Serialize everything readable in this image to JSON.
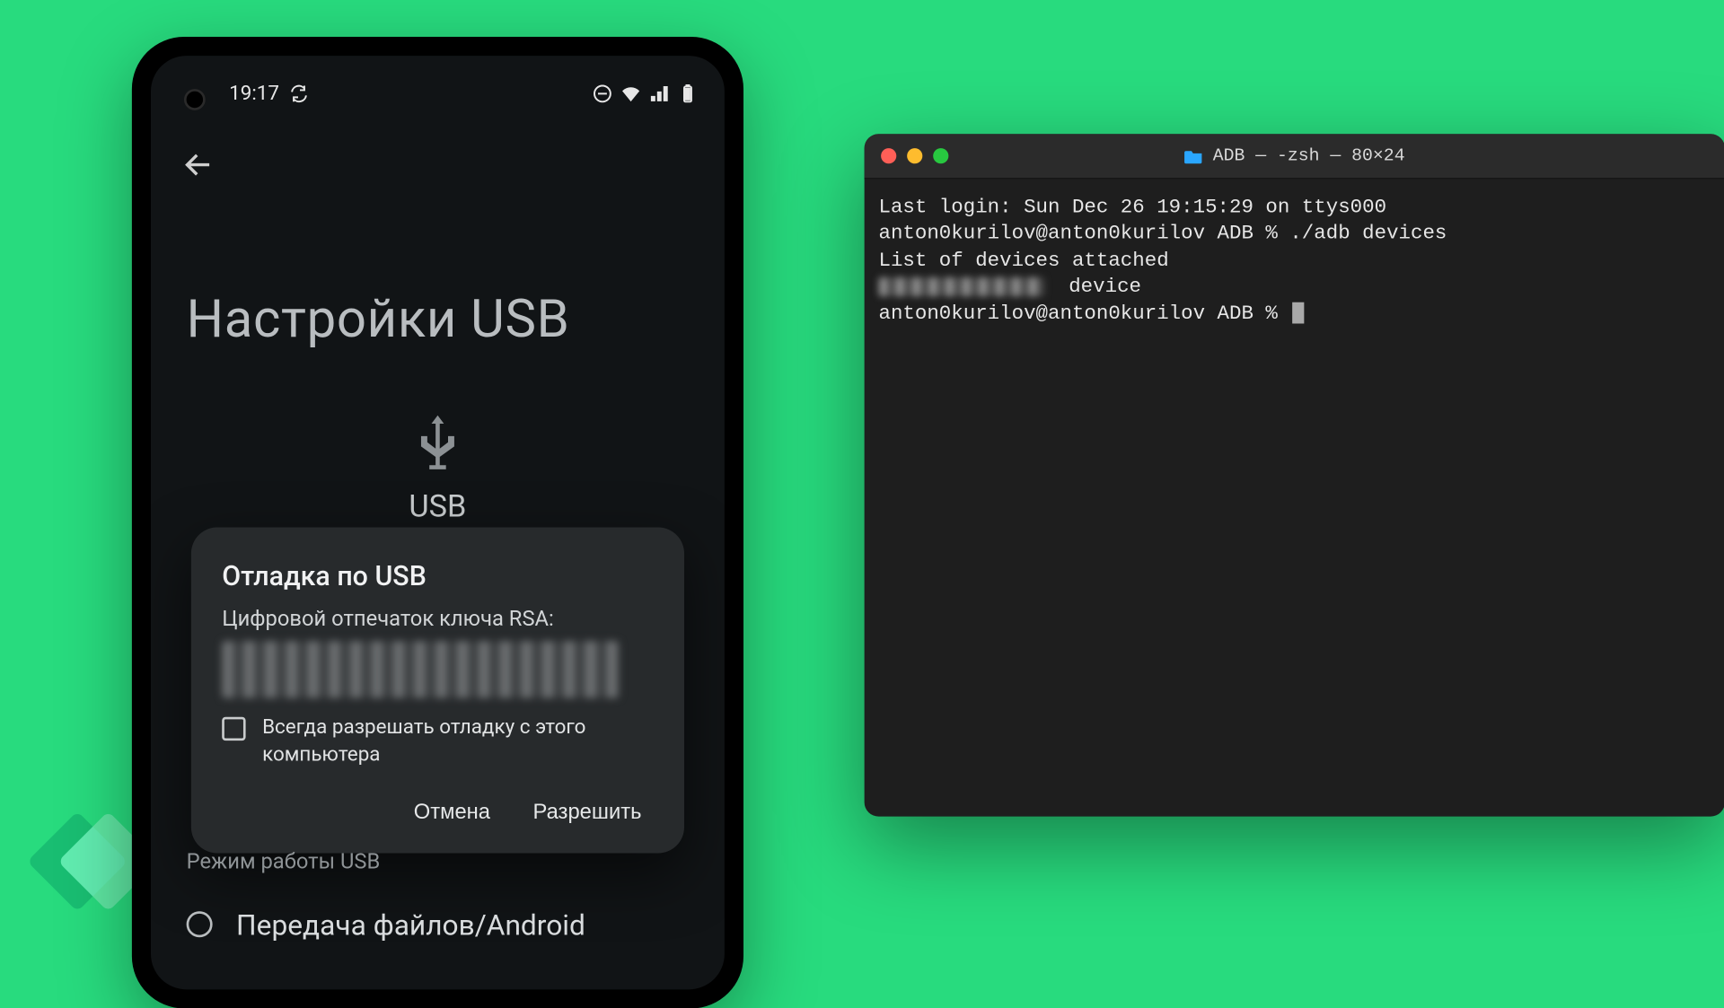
{
  "phone": {
    "status": {
      "time": "19:17",
      "sync_icon": "sync-icon",
      "dnd_icon": "do-not-disturb-icon",
      "wifi_icon": "wifi-icon",
      "signal_icon": "cellular-icon",
      "battery_icon": "battery-icon"
    },
    "back_icon": "back-arrow-icon",
    "page_title": "Настройки USB",
    "usb": {
      "icon": "usb-icon",
      "label": "USB"
    },
    "section_label": "Режим работы USB",
    "option_file_transfer": "Передача файлов/Android",
    "dialog": {
      "title": "Отладка по USB",
      "subtitle": "Цифровой отпечаток ключа RSA:",
      "checkbox_label": "Всегда разрешать отладку с этого компьютера",
      "btn_cancel": "Отмена",
      "btn_allow": "Разрешить"
    }
  },
  "terminal": {
    "title": "ADB — -zsh — 80×24",
    "folder_icon": "folder-icon",
    "lines": {
      "l1": "Last login: Sun Dec 26 19:15:29 on ttys000",
      "l2_prefix": "anton0kurilov@anton0kurilov ADB % ",
      "l2_cmd": "./adb devices",
      "l3": "List of devices attached",
      "l4_suffix": "  device",
      "l5": "",
      "l6": "anton0kurilov@anton0kurilov ADB % "
    }
  }
}
